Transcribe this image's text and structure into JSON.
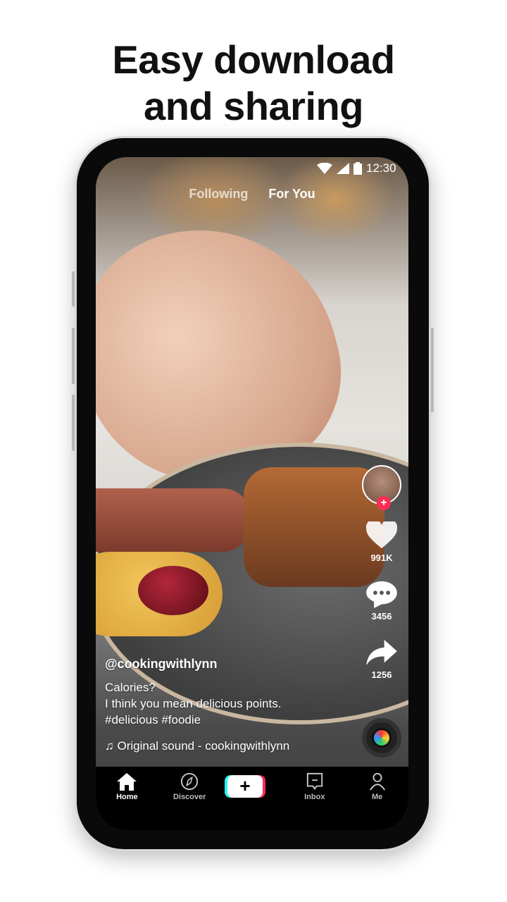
{
  "headline": {
    "line1": "Easy download",
    "line2": "and sharing"
  },
  "status": {
    "time": "12:30",
    "icons": [
      "wifi-icon",
      "signal-icon",
      "battery-icon"
    ]
  },
  "top_tabs": [
    {
      "label": "Following",
      "active": false
    },
    {
      "label": "For You",
      "active": true
    }
  ],
  "rail": {
    "likes": "991K",
    "comments": "3456",
    "shares": "1256"
  },
  "post": {
    "username": "@cookingwithlynn",
    "caption_line1": "Calories?",
    "caption_line2": "I think you mean delicious points.",
    "hashtags": "#delicious #foodie",
    "sound": "Original sound - cookingwithlynn"
  },
  "nav": [
    {
      "label": "Home",
      "icon": "home-icon"
    },
    {
      "label": "Discover",
      "icon": "compass-icon"
    },
    {
      "label": "",
      "icon": "plus-icon"
    },
    {
      "label": "Inbox",
      "icon": "inbox-icon"
    },
    {
      "label": "Me",
      "icon": "person-icon"
    }
  ],
  "colors": {
    "accent_red": "#fe2c55",
    "accent_cyan": "#25f4ee"
  }
}
